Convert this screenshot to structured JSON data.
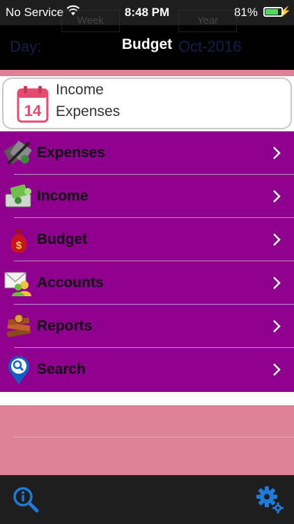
{
  "status": {
    "carrier": "No Service",
    "time": "8:48 PM",
    "battery_text": "81%",
    "battery_level": 0.81
  },
  "ghost": {
    "tab_week": "Week",
    "tab_year": "Year",
    "day_label": "Day:",
    "date_fragment": "Oct-2016"
  },
  "nav": {
    "title": "Budget"
  },
  "header": {
    "line1": "Income",
    "line2": "Expenses",
    "calendar_day": "14"
  },
  "menu": {
    "items": [
      {
        "label": "Expenses"
      },
      {
        "label": "Income"
      },
      {
        "label": "Budget"
      },
      {
        "label": "Accounts"
      },
      {
        "label": "Reports"
      },
      {
        "label": "Search"
      }
    ]
  },
  "colors": {
    "menu_bg": "#8f008f",
    "pink": "#dd8297",
    "toolbar_bg": "#1e1e1e",
    "accent_blue": "#1e7bd8",
    "battery_green": "#4cd964"
  }
}
